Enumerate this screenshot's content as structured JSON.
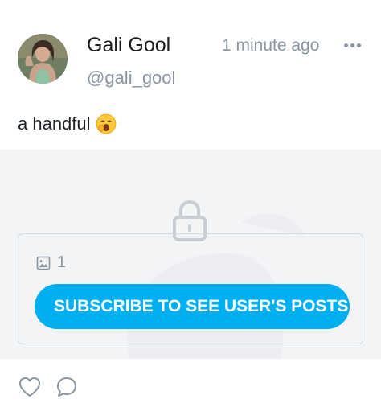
{
  "post": {
    "author": {
      "display_name": "Gali Gool",
      "handle": "@gali_gool",
      "avatar_icon": "profile-photo"
    },
    "timestamp": "1 minute ago",
    "more_icon": "more-horizontal-icon",
    "caption": "a handful",
    "caption_emoji": "yawning-face-emoji",
    "media": {
      "locked": true,
      "lock_icon": "lock-icon",
      "count_icon": "image-icon",
      "count": "1",
      "subscribe_label": "SUBSCRIBE TO SEE USER'S POSTS"
    },
    "actions": [
      {
        "icon": "heart-icon"
      },
      {
        "icon": "comment-icon"
      }
    ]
  },
  "colors": {
    "accent": "#00aff0",
    "muted_text": "#8a96a3",
    "media_background": "#f4f5f7"
  }
}
